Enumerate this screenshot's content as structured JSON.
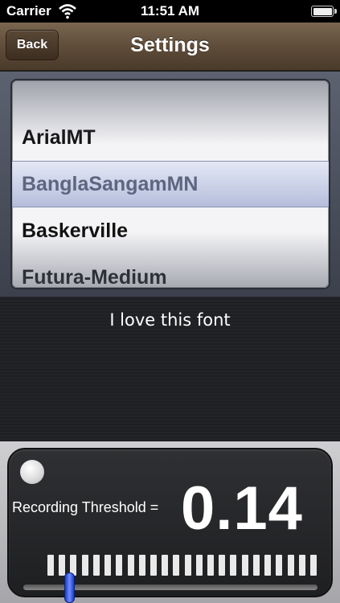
{
  "status_bar": {
    "carrier": "Carrier",
    "time": "11:51 AM",
    "wifi_icon": "wifi-icon",
    "battery_icon": "battery-icon"
  },
  "nav": {
    "back_label": "Back",
    "title": "Settings"
  },
  "picker": {
    "items": [
      "ArialMT",
      "BanglaSangamMN",
      "Baskerville",
      "Futura-Medium"
    ],
    "selected": "BanglaSangamMN"
  },
  "preview": {
    "text": "I love this font"
  },
  "meter": {
    "label": "Recording Threshold =",
    "value": "0.14",
    "slider_fraction": 0.14,
    "tick_count": 24
  },
  "colors": {
    "nav_brown": "#5f4d3a",
    "slider_blue": "#1a3cc0"
  }
}
